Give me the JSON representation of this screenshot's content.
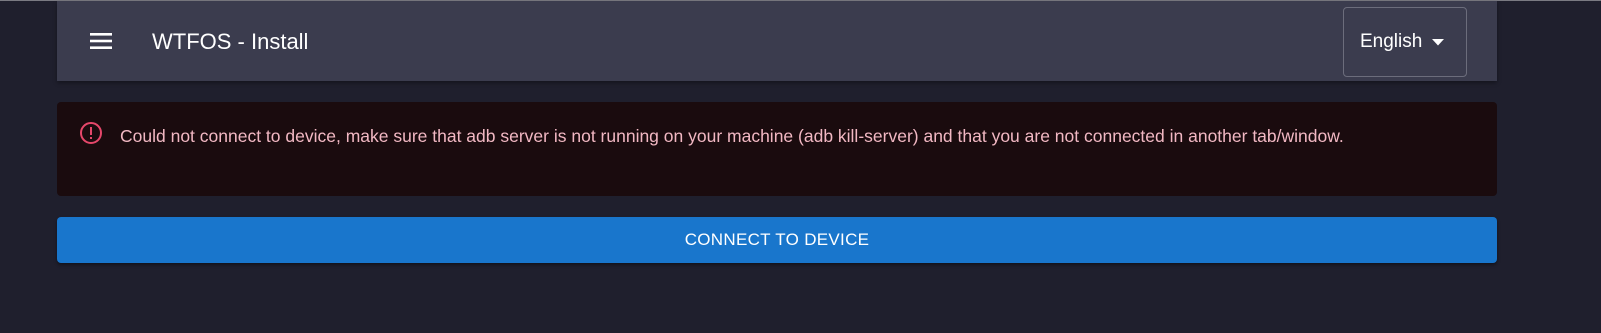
{
  "appbar": {
    "menu_icon": "hamburger-menu-icon",
    "title": "WTFOS - Install",
    "language": {
      "selected": "English",
      "caret_icon": "caret-down-icon"
    }
  },
  "alert": {
    "severity": "error",
    "icon": "error-outline-icon",
    "message": "Could not connect to device, make sure that adb server is not running on your machine (adb kill-server) and that you are not connected in another tab/window."
  },
  "actions": {
    "connect_label": "CONNECT TO DEVICE"
  },
  "colors": {
    "background": "#1f1f2d",
    "appbar": "#3b3c4e",
    "alert_background": "#1a0b0e",
    "alert_text": "#f2b8c3",
    "alert_icon": "#e5476a",
    "primary_button": "#1976cc"
  }
}
